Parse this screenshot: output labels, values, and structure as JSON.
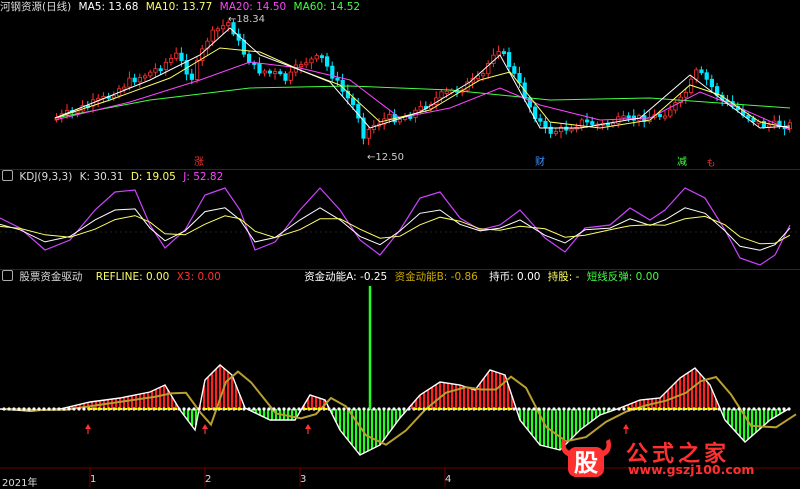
{
  "main": {
    "title": "河钢资源(日线)",
    "ma": [
      {
        "label": "MA5: 13.68",
        "color": "#ffffff"
      },
      {
        "label": "MA10: 13.77",
        "color": "#ffff66"
      },
      {
        "label": "MA20: 14.50",
        "color": "#ff44ff"
      },
      {
        "label": "MA60: 14.52",
        "color": "#44ff44"
      }
    ],
    "high_label": "18.34",
    "low_label": "12.50",
    "tags": [
      {
        "text": "涨",
        "color": "#ff3030"
      },
      {
        "text": "财",
        "color": "#3f8fff"
      },
      {
        "text": "减",
        "color": "#40ff40"
      },
      {
        "text": "も",
        "color": "#ff3030"
      }
    ]
  },
  "kdj": {
    "name": "KDJ(9,3,3)",
    "k": "K: 30.31",
    "d": "D: 19.05",
    "j": "J: 52.82"
  },
  "fund": {
    "name": "股票资金驱动",
    "refline": "REFLINE: 0.00",
    "x3": "X3: 0.00",
    "a": "资金动能A: -0.25",
    "b": "资金动能B: -0.86",
    "hold": "持币: 0.00",
    "holdstock": "持股: -",
    "rebound": "短线反弹: 0.00"
  },
  "axis": {
    "year": "2021年",
    "months": [
      "1",
      "2",
      "3",
      "4"
    ]
  },
  "watermark": {
    "logo": "股",
    "text": "公式之家",
    "url": "www.gszj100.com"
  },
  "colors": {
    "up": "#ff3030",
    "down": "#00e5ff",
    "bar_green": "#20ff20",
    "bar_red": "#ff2020",
    "border": "#8b0000"
  }
}
